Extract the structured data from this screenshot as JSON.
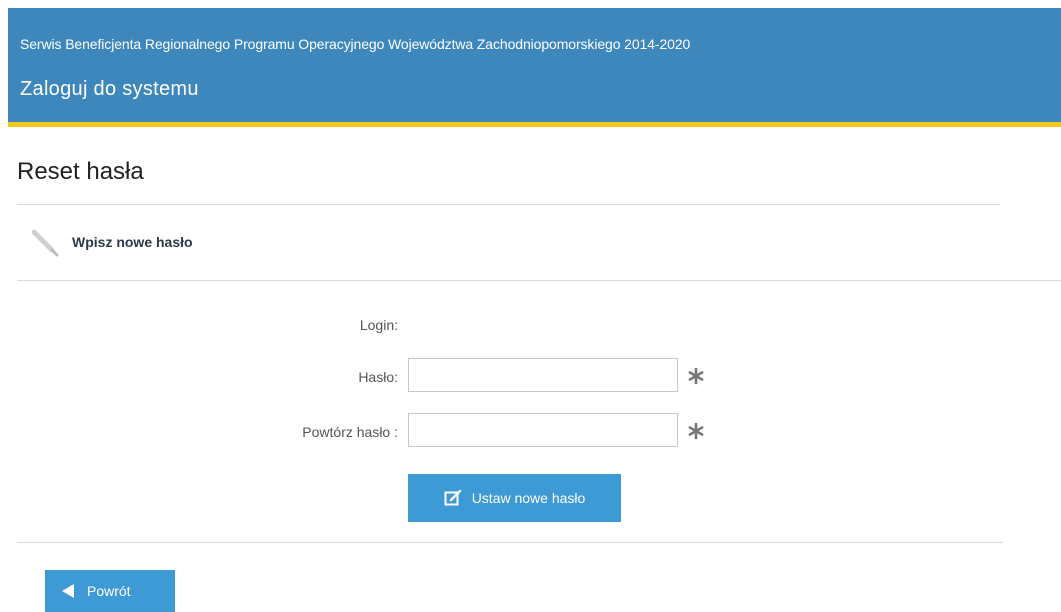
{
  "header": {
    "subtitle": "Serwis Beneficjenta Regionalnego Programu Operacyjnego Województwa Zachodniopomorskiego 2014-2020",
    "title": "Zaloguj do systemu"
  },
  "page": {
    "title": "Reset hasła",
    "section_label": "Wpisz nowe hasło"
  },
  "form": {
    "login_label": "Login:",
    "login_value": "",
    "password_label": "Hasło:",
    "password_value": "",
    "repeat_label": "Powtórz hasło :",
    "repeat_value": "",
    "submit_label": "Ustaw nowe hasło"
  },
  "footer": {
    "back_label": "Powrót"
  },
  "colors": {
    "header_bg": "#3d87bd",
    "stripe": "#f2c81e",
    "button_bg": "#3d9ad4"
  },
  "icons": {
    "section": "pencil-icon",
    "required": "asterisk-icon",
    "submit": "edit-icon",
    "back": "triangle-left-icon"
  }
}
